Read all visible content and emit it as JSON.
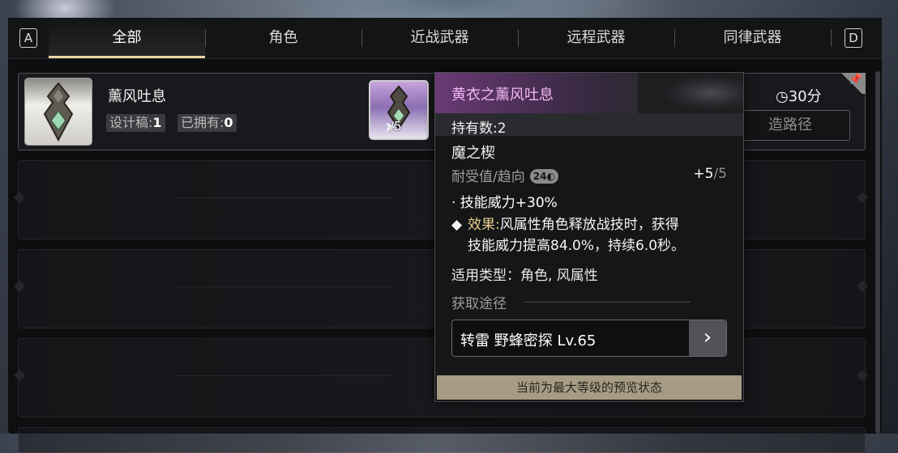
{
  "tabs": {
    "left_key": "A",
    "right_key": "D",
    "items": [
      {
        "label": "全部",
        "active": true
      },
      {
        "label": "角色",
        "active": false
      },
      {
        "label": "近战武器",
        "active": false
      },
      {
        "label": "远程武器",
        "active": false
      },
      {
        "label": "同律武器",
        "active": false
      }
    ]
  },
  "item": {
    "name": "薰风吐息",
    "design_label": "设计稿:",
    "design_value": "1",
    "owned_label": "已拥有:",
    "owned_value": "0",
    "mini_count": "/5",
    "timer": "30分",
    "route_button": "造路径",
    "icon": "mod-emblem-icon"
  },
  "tooltip": {
    "title": "黄衣之薰风吐息",
    "own_count": "持有数:2",
    "category": "魔之楔",
    "durability_label": "耐受值/趋向",
    "durability_value": "24",
    "refine_current": "+5",
    "refine_max": "/5",
    "stat_line": "· 技能威力+30%",
    "effect_bullet": "◆",
    "effect_label": "效果:",
    "effect_text_1": "风属性角色释放战技时，获得",
    "effect_text_2": "技能威力提高84.0%，持续6.0秒。",
    "type_line": "适用类型：角色, 风属性",
    "source_label": "获取途径",
    "source_item": "转雷 野蜂密探 Lv.65",
    "footer": "当前为最大等级的预览状态"
  },
  "colors": {
    "tab_active_underline": "#e8d7a6",
    "tooltip_title": "#f4b6f5",
    "effect_gold": "#e6cf8d",
    "footer_bg": "#a69b84"
  }
}
